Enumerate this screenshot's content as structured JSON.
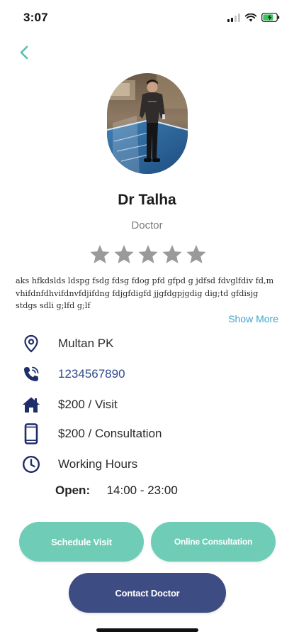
{
  "status_bar": {
    "time": "3:07"
  },
  "profile": {
    "name": "Dr Talha",
    "role": "Doctor",
    "rating": 0,
    "rating_max": 5,
    "bio": "aks hfkdslds ldspg fsdg fdsg fdog pfd gfpd g jdfsd fdvglfdiv fd,m vhifdnfdhvifdnvfdjifdng fdjgfdigfd jjgfdgpjgdig dig;td gfdisjg stdgs sdli g;lfd g;lf",
    "show_more_label": "Show More"
  },
  "info": {
    "location": "Multan PK",
    "phone": "1234567890",
    "visit_fee": "$200 / Visit",
    "consultation_fee": "$200 / Consultation",
    "working_hours_label": "Working Hours",
    "open_label": "Open:",
    "open_hours": "14:00 - 23:00"
  },
  "actions": {
    "schedule_visit": "Schedule Visit",
    "online_consultation": "Online Consultation",
    "contact_doctor": "Contact Doctor"
  },
  "colors": {
    "accent_teal": "#6fcdb7",
    "navy": "#3e4c84",
    "icon_navy": "#1f2d6b",
    "link_blue": "#3fa4c9",
    "star_gray": "#9a9a9a"
  },
  "icons": {
    "back": "chevron-left-icon",
    "location": "location-pin-icon",
    "phone": "phone-icon",
    "visit": "home-icon",
    "consultation": "mobile-phone-icon",
    "hours": "clock-icon"
  }
}
